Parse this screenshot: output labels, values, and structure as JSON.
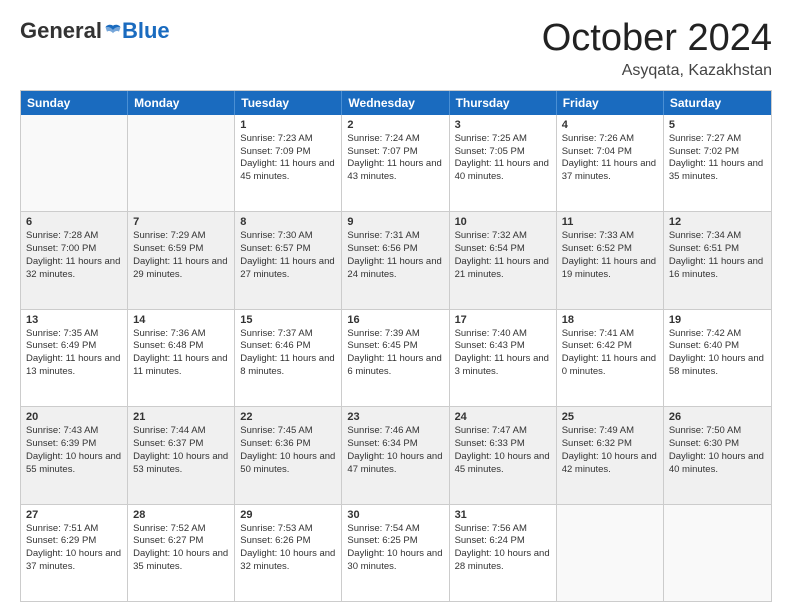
{
  "header": {
    "logo_general": "General",
    "logo_blue": "Blue",
    "month_title": "October 2024",
    "location": "Asyqata, Kazakhstan"
  },
  "calendar": {
    "days_of_week": [
      "Sunday",
      "Monday",
      "Tuesday",
      "Wednesday",
      "Thursday",
      "Friday",
      "Saturday"
    ],
    "rows": [
      [
        {
          "day": "",
          "sunrise": "",
          "sunset": "",
          "daylight": "",
          "empty": true
        },
        {
          "day": "",
          "sunrise": "",
          "sunset": "",
          "daylight": "",
          "empty": true
        },
        {
          "day": "1",
          "sunrise": "Sunrise: 7:23 AM",
          "sunset": "Sunset: 7:09 PM",
          "daylight": "Daylight: 11 hours and 45 minutes.",
          "empty": false
        },
        {
          "day": "2",
          "sunrise": "Sunrise: 7:24 AM",
          "sunset": "Sunset: 7:07 PM",
          "daylight": "Daylight: 11 hours and 43 minutes.",
          "empty": false
        },
        {
          "day": "3",
          "sunrise": "Sunrise: 7:25 AM",
          "sunset": "Sunset: 7:05 PM",
          "daylight": "Daylight: 11 hours and 40 minutes.",
          "empty": false
        },
        {
          "day": "4",
          "sunrise": "Sunrise: 7:26 AM",
          "sunset": "Sunset: 7:04 PM",
          "daylight": "Daylight: 11 hours and 37 minutes.",
          "empty": false
        },
        {
          "day": "5",
          "sunrise": "Sunrise: 7:27 AM",
          "sunset": "Sunset: 7:02 PM",
          "daylight": "Daylight: 11 hours and 35 minutes.",
          "empty": false
        }
      ],
      [
        {
          "day": "6",
          "sunrise": "Sunrise: 7:28 AM",
          "sunset": "Sunset: 7:00 PM",
          "daylight": "Daylight: 11 hours and 32 minutes.",
          "empty": false
        },
        {
          "day": "7",
          "sunrise": "Sunrise: 7:29 AM",
          "sunset": "Sunset: 6:59 PM",
          "daylight": "Daylight: 11 hours and 29 minutes.",
          "empty": false
        },
        {
          "day": "8",
          "sunrise": "Sunrise: 7:30 AM",
          "sunset": "Sunset: 6:57 PM",
          "daylight": "Daylight: 11 hours and 27 minutes.",
          "empty": false
        },
        {
          "day": "9",
          "sunrise": "Sunrise: 7:31 AM",
          "sunset": "Sunset: 6:56 PM",
          "daylight": "Daylight: 11 hours and 24 minutes.",
          "empty": false
        },
        {
          "day": "10",
          "sunrise": "Sunrise: 7:32 AM",
          "sunset": "Sunset: 6:54 PM",
          "daylight": "Daylight: 11 hours and 21 minutes.",
          "empty": false
        },
        {
          "day": "11",
          "sunrise": "Sunrise: 7:33 AM",
          "sunset": "Sunset: 6:52 PM",
          "daylight": "Daylight: 11 hours and 19 minutes.",
          "empty": false
        },
        {
          "day": "12",
          "sunrise": "Sunrise: 7:34 AM",
          "sunset": "Sunset: 6:51 PM",
          "daylight": "Daylight: 11 hours and 16 minutes.",
          "empty": false
        }
      ],
      [
        {
          "day": "13",
          "sunrise": "Sunrise: 7:35 AM",
          "sunset": "Sunset: 6:49 PM",
          "daylight": "Daylight: 11 hours and 13 minutes.",
          "empty": false
        },
        {
          "day": "14",
          "sunrise": "Sunrise: 7:36 AM",
          "sunset": "Sunset: 6:48 PM",
          "daylight": "Daylight: 11 hours and 11 minutes.",
          "empty": false
        },
        {
          "day": "15",
          "sunrise": "Sunrise: 7:37 AM",
          "sunset": "Sunset: 6:46 PM",
          "daylight": "Daylight: 11 hours and 8 minutes.",
          "empty": false
        },
        {
          "day": "16",
          "sunrise": "Sunrise: 7:39 AM",
          "sunset": "Sunset: 6:45 PM",
          "daylight": "Daylight: 11 hours and 6 minutes.",
          "empty": false
        },
        {
          "day": "17",
          "sunrise": "Sunrise: 7:40 AM",
          "sunset": "Sunset: 6:43 PM",
          "daylight": "Daylight: 11 hours and 3 minutes.",
          "empty": false
        },
        {
          "day": "18",
          "sunrise": "Sunrise: 7:41 AM",
          "sunset": "Sunset: 6:42 PM",
          "daylight": "Daylight: 11 hours and 0 minutes.",
          "empty": false
        },
        {
          "day": "19",
          "sunrise": "Sunrise: 7:42 AM",
          "sunset": "Sunset: 6:40 PM",
          "daylight": "Daylight: 10 hours and 58 minutes.",
          "empty": false
        }
      ],
      [
        {
          "day": "20",
          "sunrise": "Sunrise: 7:43 AM",
          "sunset": "Sunset: 6:39 PM",
          "daylight": "Daylight: 10 hours and 55 minutes.",
          "empty": false
        },
        {
          "day": "21",
          "sunrise": "Sunrise: 7:44 AM",
          "sunset": "Sunset: 6:37 PM",
          "daylight": "Daylight: 10 hours and 53 minutes.",
          "empty": false
        },
        {
          "day": "22",
          "sunrise": "Sunrise: 7:45 AM",
          "sunset": "Sunset: 6:36 PM",
          "daylight": "Daylight: 10 hours and 50 minutes.",
          "empty": false
        },
        {
          "day": "23",
          "sunrise": "Sunrise: 7:46 AM",
          "sunset": "Sunset: 6:34 PM",
          "daylight": "Daylight: 10 hours and 47 minutes.",
          "empty": false
        },
        {
          "day": "24",
          "sunrise": "Sunrise: 7:47 AM",
          "sunset": "Sunset: 6:33 PM",
          "daylight": "Daylight: 10 hours and 45 minutes.",
          "empty": false
        },
        {
          "day": "25",
          "sunrise": "Sunrise: 7:49 AM",
          "sunset": "Sunset: 6:32 PM",
          "daylight": "Daylight: 10 hours and 42 minutes.",
          "empty": false
        },
        {
          "day": "26",
          "sunrise": "Sunrise: 7:50 AM",
          "sunset": "Sunset: 6:30 PM",
          "daylight": "Daylight: 10 hours and 40 minutes.",
          "empty": false
        }
      ],
      [
        {
          "day": "27",
          "sunrise": "Sunrise: 7:51 AM",
          "sunset": "Sunset: 6:29 PM",
          "daylight": "Daylight: 10 hours and 37 minutes.",
          "empty": false
        },
        {
          "day": "28",
          "sunrise": "Sunrise: 7:52 AM",
          "sunset": "Sunset: 6:27 PM",
          "daylight": "Daylight: 10 hours and 35 minutes.",
          "empty": false
        },
        {
          "day": "29",
          "sunrise": "Sunrise: 7:53 AM",
          "sunset": "Sunset: 6:26 PM",
          "daylight": "Daylight: 10 hours and 32 minutes.",
          "empty": false
        },
        {
          "day": "30",
          "sunrise": "Sunrise: 7:54 AM",
          "sunset": "Sunset: 6:25 PM",
          "daylight": "Daylight: 10 hours and 30 minutes.",
          "empty": false
        },
        {
          "day": "31",
          "sunrise": "Sunrise: 7:56 AM",
          "sunset": "Sunset: 6:24 PM",
          "daylight": "Daylight: 10 hours and 28 minutes.",
          "empty": false
        },
        {
          "day": "",
          "sunrise": "",
          "sunset": "",
          "daylight": "",
          "empty": true
        },
        {
          "day": "",
          "sunrise": "",
          "sunset": "",
          "daylight": "",
          "empty": true
        }
      ]
    ]
  }
}
